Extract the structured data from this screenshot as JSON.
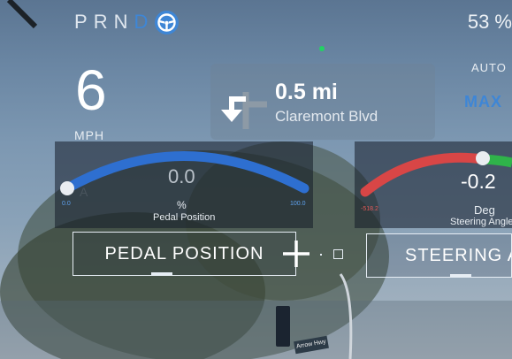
{
  "status_bar": {
    "gears": [
      "P",
      "R",
      "N",
      "D"
    ],
    "active_gear": "D",
    "battery": "53 %"
  },
  "speed": {
    "value": "6",
    "unit": "MPH"
  },
  "navigation": {
    "distance": "0.5 mi",
    "street": "Claremont Blvd",
    "icon": "turn-left-arrow-icon"
  },
  "headlights": {
    "mode": "AUTO",
    "beam": "MAX"
  },
  "gauges": {
    "pedal": {
      "value": "0.0",
      "unit": "%",
      "label": "Pedal Position",
      "min": "0.0",
      "max": "100.0",
      "level": 0.0
    },
    "steering": {
      "value": "-0.2",
      "unit": "Deg",
      "label": "Steering Angle",
      "min": "-518.2"
    }
  },
  "buttons": {
    "pedal_position": "PEDAL POSITION",
    "steering_angle": "STEERING ANGLE"
  },
  "street_sign": "Arrow Hwy",
  "colors": {
    "accent": "#3e86d6",
    "status_ok": "#23d164",
    "steer_neg": "#e25a5a",
    "steer_pos": "#2fb34a"
  }
}
